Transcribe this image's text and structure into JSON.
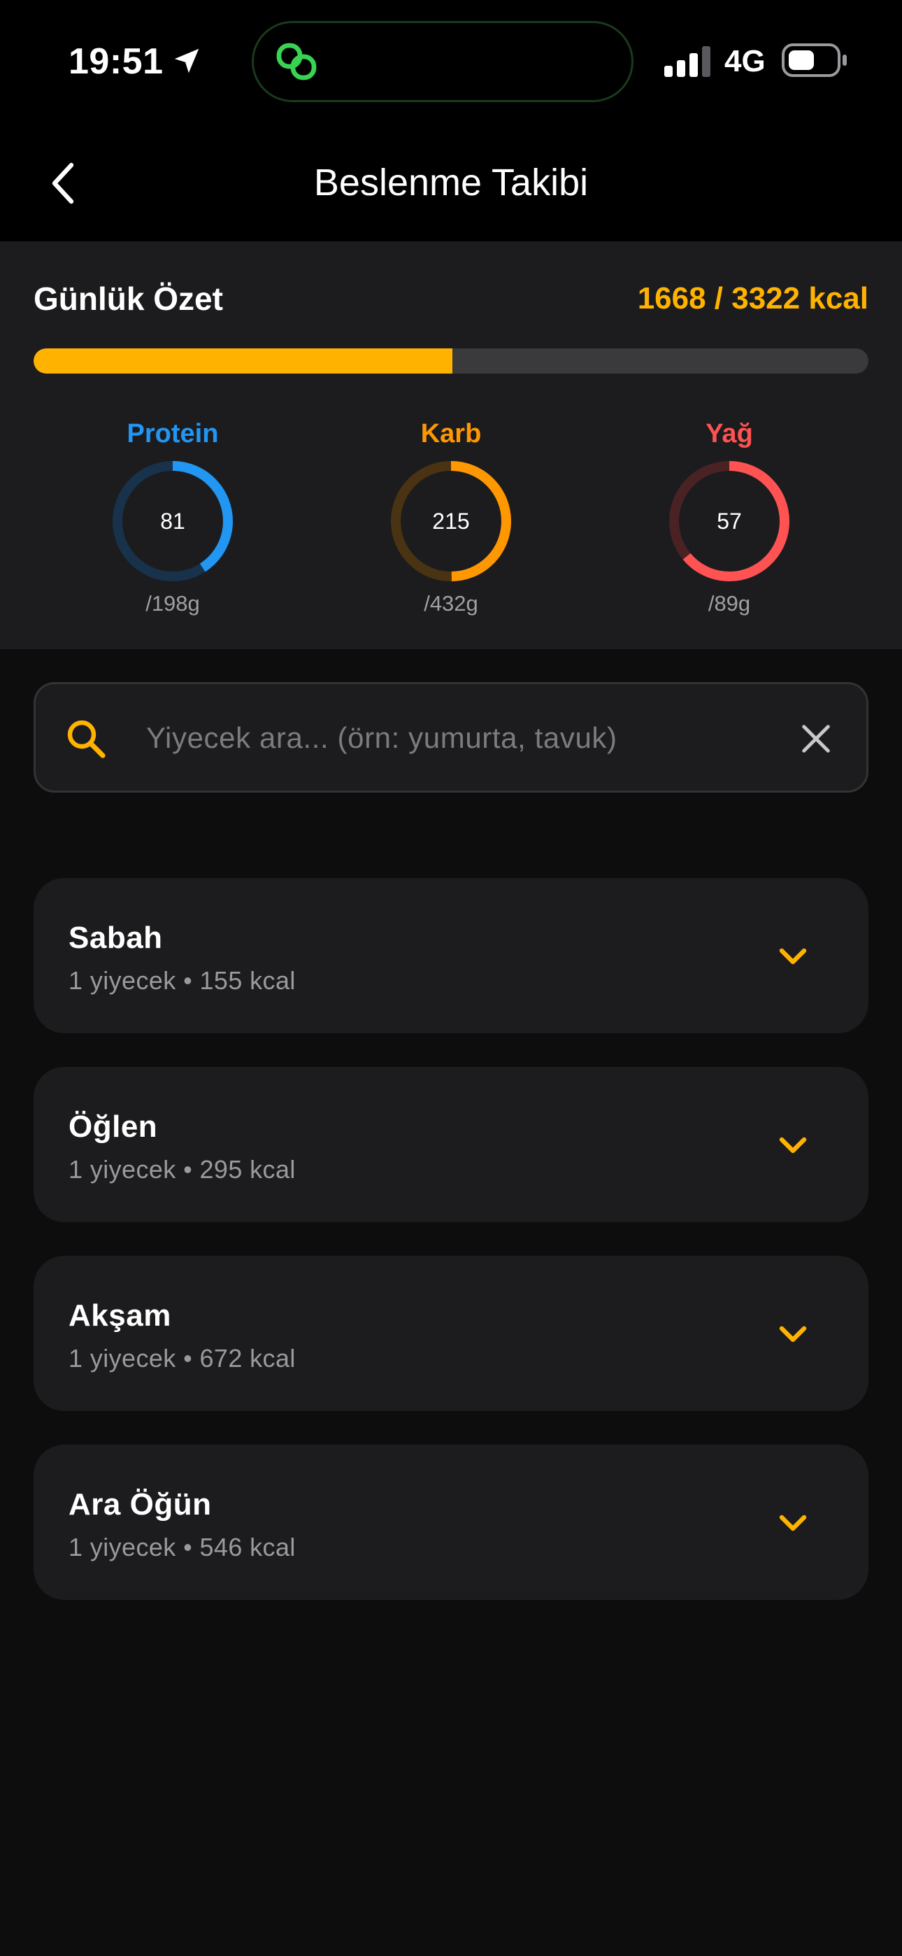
{
  "status_bar": {
    "time": "19:51",
    "network": "4G",
    "icons": [
      "location-arrow-icon",
      "linked-rings-icon",
      "cellular-signal-icon",
      "battery-icon"
    ]
  },
  "nav": {
    "title": "Beslenme Takibi",
    "back_icon": "chevron-left-icon"
  },
  "summary": {
    "title": "Günlük Özet",
    "kcal_text": "1668 / 3322 kcal",
    "progress_fraction": 0.502,
    "macros": [
      {
        "name": "Protein",
        "value": "81",
        "target": "/198g",
        "fraction": 0.409,
        "color": "#2196f3",
        "track_color": "#17324a"
      },
      {
        "name": "Karb",
        "value": "215",
        "target": "/432g",
        "fraction": 0.498,
        "color": "#ff9800",
        "track_color": "#4a3312"
      },
      {
        "name": "Yağ",
        "value": "57",
        "target": "/89g",
        "fraction": 0.64,
        "color": "#ff5252",
        "track_color": "#4a2224"
      }
    ]
  },
  "search": {
    "placeholder": "Yiyecek ara... (örn: yumurta, tavuk)",
    "value": "",
    "search_icon": "search-icon",
    "clear_icon": "close-icon"
  },
  "meals": [
    {
      "name": "Sabah",
      "meta": "1 yiyecek • 155 kcal"
    },
    {
      "name": "Öğlen",
      "meta": "1 yiyecek • 295 kcal"
    },
    {
      "name": "Akşam",
      "meta": "1 yiyecek • 672 kcal"
    },
    {
      "name": "Ara Öğün",
      "meta": "1 yiyecek • 546 kcal"
    }
  ],
  "colors": {
    "accent": "#ffb300",
    "background": "#0d0d0d",
    "card": "#1c1c1e"
  }
}
